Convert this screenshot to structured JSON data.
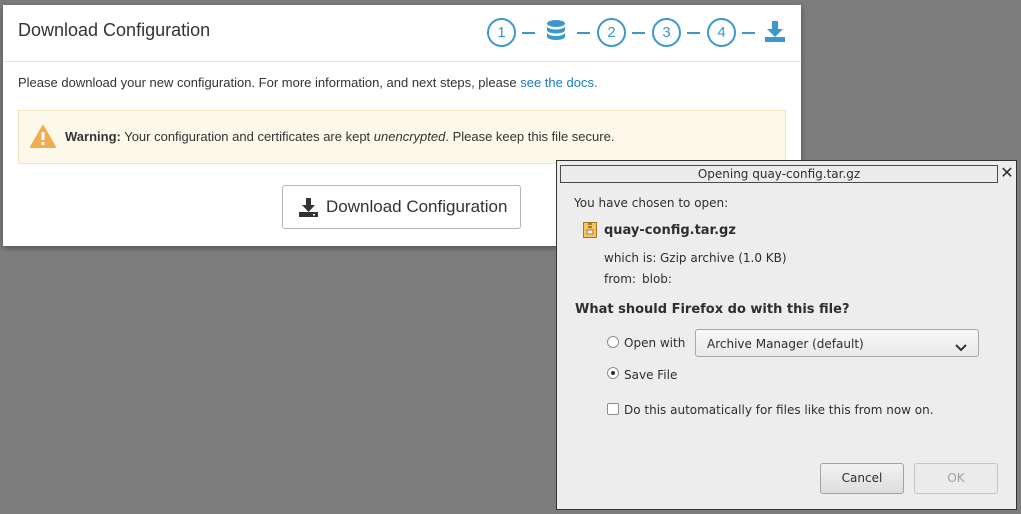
{
  "modal": {
    "title": "Download Configuration",
    "steps": [
      "1",
      "2",
      "3",
      "4"
    ],
    "intro": "Please download your new configuration. For more information, and next steps, please ",
    "docs_link": "see the docs.",
    "warning_label": "Warning:",
    "warning_text_1": " Your configuration and certificates are kept ",
    "warning_emph": "unencrypted",
    "warning_text_2": ". Please keep this file secure.",
    "download_button": "Download Configuration",
    "accent_color": "#3c98cc",
    "warning_icon_color": "#f0ad4e"
  },
  "dialog": {
    "title": "Opening quay-config.tar.gz",
    "close": "✕",
    "chosen_text": "You have chosen to open:",
    "filename": "quay-config.tar.gz",
    "which_is_label": "which is:",
    "which_is_value": "Gzip archive (1.0 KB)",
    "from_label": "from:",
    "from_value": "blob:",
    "question": "What should Firefox do with this file?",
    "open_with_label": "Open with",
    "open_with_selected": "Archive Manager (default)",
    "save_file_label": "Save File",
    "auto_label": "Do this automatically for files like this from now on.",
    "cancel_button": "Cancel",
    "ok_button": "OK"
  }
}
